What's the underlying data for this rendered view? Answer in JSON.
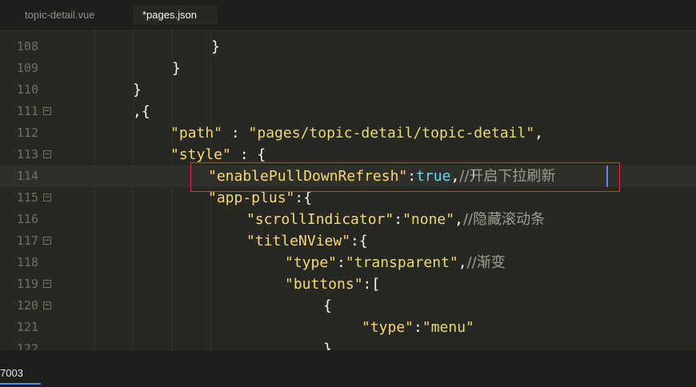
{
  "tabs": [
    {
      "label": "topic-detail.vue",
      "active": false
    },
    {
      "label": "*pages.json",
      "active": true
    }
  ],
  "status": {
    "text": "7003"
  },
  "code_lines": [
    {
      "num": "108",
      "fold": false
    },
    {
      "num": "109",
      "fold": false
    },
    {
      "num": "110",
      "fold": false
    },
    {
      "num": "111",
      "fold": true
    },
    {
      "num": "112",
      "fold": false
    },
    {
      "num": "113",
      "fold": true
    },
    {
      "num": "114",
      "fold": false
    },
    {
      "num": "115",
      "fold": true
    },
    {
      "num": "116",
      "fold": false
    },
    {
      "num": "117",
      "fold": true
    },
    {
      "num": "118",
      "fold": false
    },
    {
      "num": "119",
      "fold": true
    },
    {
      "num": "120",
      "fold": true
    },
    {
      "num": "121",
      "fold": false
    },
    {
      "num": "122",
      "fold": false
    }
  ],
  "tokens": {
    "l108": "}",
    "l109": "}",
    "l110": "}",
    "l111": ",{",
    "l112_key": "\"path\"",
    "l112_sep": " : ",
    "l112_val": "\"pages/topic-detail/topic-detail\"",
    "l112_end": ",",
    "l113_key": "\"style\"",
    "l113_sep": " : {",
    "l114_key": "\"enablePullDownRefresh\"",
    "l114_sep": ":",
    "l114_val": "true",
    "l114_comma": ",",
    "l114_cmt": "//开启下拉刷新",
    "l115_key": "\"app-plus\"",
    "l115_sep": ":{",
    "l116_key": "\"scrollIndicator\"",
    "l116_sep": ":",
    "l116_val": "\"none\"",
    "l116_comma": ",",
    "l116_cmt": "//隐藏滚动条",
    "l117_key": "\"titleNView\"",
    "l117_sep": ":{",
    "l118_key": "\"type\"",
    "l118_sep": ":",
    "l118_val": "\"transparent\"",
    "l118_comma": ",",
    "l118_cmt": "//渐变",
    "l119_key": "\"buttons\"",
    "l119_sep": ":[",
    "l120": "{",
    "l121_key": "\"type\"",
    "l121_sep": ":",
    "l121_val": "\"menu\"",
    "l122": "}"
  },
  "colors": {
    "background": "#272822",
    "key": "#f8d878",
    "string": "#e6db74",
    "keyword": "#66d9ef",
    "comment": "#9d9d93",
    "highlight_box": "#e23232",
    "cursor": "#5b8cff"
  },
  "icons": {
    "fold": "fold-toggle-icon",
    "text_cursor": "ibeam-cursor-icon"
  }
}
